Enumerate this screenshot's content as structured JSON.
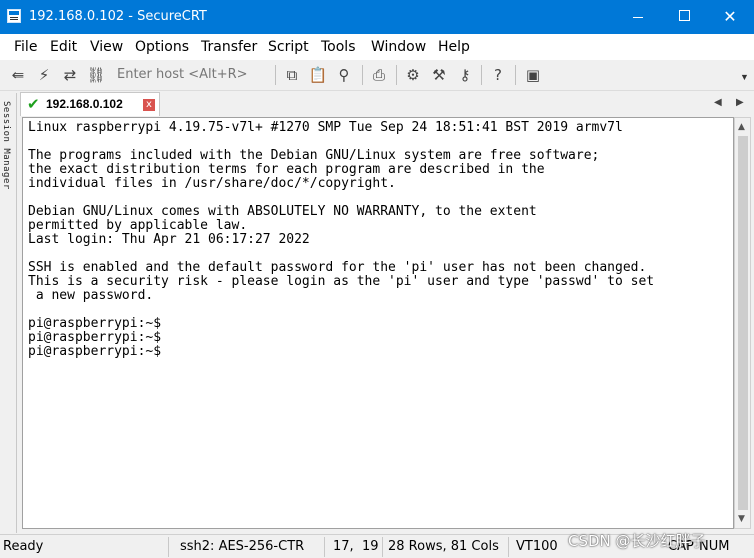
{
  "window": {
    "title": "192.168.0.102 - SecureCRT"
  },
  "menu": [
    {
      "label": "File"
    },
    {
      "label": "Edit"
    },
    {
      "label": "View"
    },
    {
      "label": "Options"
    },
    {
      "label": "Transfer"
    },
    {
      "label": "Script"
    },
    {
      "label": "Tools"
    },
    {
      "label": "Window"
    },
    {
      "label": "Help"
    }
  ],
  "toolbar": {
    "host_placeholder": "Enter host <Alt+R>"
  },
  "session_manager": {
    "label": "Session Manager"
  },
  "tab": {
    "label": "192.168.0.102",
    "close": "x"
  },
  "terminal": {
    "lines": [
      "Linux raspberrypi 4.19.75-v7l+ #1270 SMP Tue Sep 24 18:51:41 BST 2019 armv7l",
      "",
      "The programs included with the Debian GNU/Linux system are free software;",
      "the exact distribution terms for each program are described in the",
      "individual files in /usr/share/doc/*/copyright.",
      "",
      "Debian GNU/Linux comes with ABSOLUTELY NO WARRANTY, to the extent",
      "permitted by applicable law.",
      "Last login: Thu Apr 21 06:17:27 2022",
      "",
      "SSH is enabled and the default password for the 'pi' user has not been changed.",
      "This is a security risk - please login as the 'pi' user and type 'passwd' to set",
      " a new password.",
      "",
      "pi@raspberrypi:~$",
      "pi@raspberrypi:~$",
      "pi@raspberrypi:~$"
    ]
  },
  "status": {
    "ready": "Ready",
    "cipher": "ssh2: AES-256-CTR",
    "position": "17,  19",
    "size": "28 Rows, 81 Cols",
    "terminal_type": "VT100",
    "caps": "CAP",
    "num": "NUM"
  },
  "watermark": "CSDN @长沙红胖子"
}
